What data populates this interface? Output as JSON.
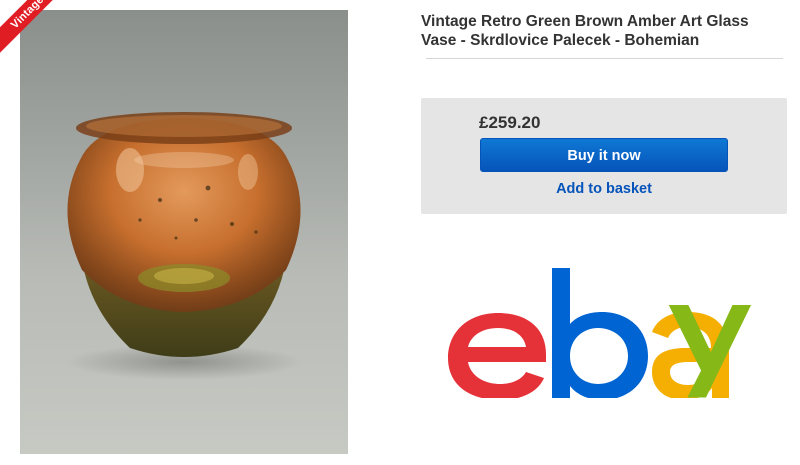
{
  "listing": {
    "title": "Vintage Retro Green Brown Amber Art Glass Vase - Skrdlovice Palecek - Bohemian",
    "badge": "Vintage",
    "image_alt": "Amber and green art glass vase"
  },
  "buy_box": {
    "price": "£259.20",
    "buy_now_label": "Buy it now",
    "add_to_basket_label": "Add to basket"
  },
  "logo": {
    "letters": [
      "e",
      "b",
      "a",
      "y"
    ],
    "colors": [
      "#e53238",
      "#0064d2",
      "#f5af02",
      "#86b817"
    ]
  },
  "colors": {
    "accent": "#0654ba",
    "badge": "#e11d24",
    "panel": "#e5e5e5"
  }
}
